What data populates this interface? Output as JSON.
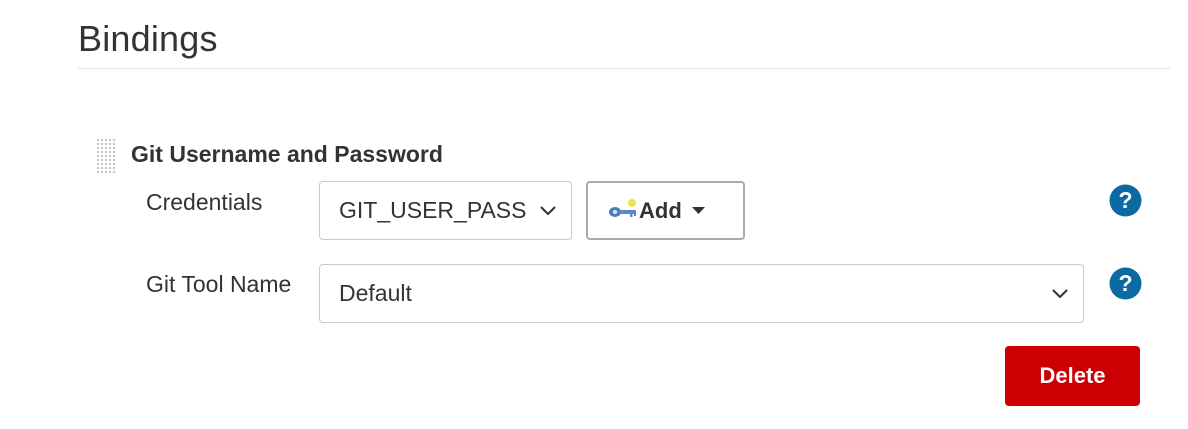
{
  "section": {
    "title": "Bindings"
  },
  "binding": {
    "title": "Git Username and Password",
    "credentials": {
      "label": "Credentials",
      "selected": "GIT_USER_PASS",
      "add_label": "Add"
    },
    "git_tool": {
      "label": "Git Tool Name",
      "selected": "Default"
    },
    "delete_label": "Delete"
  },
  "icons": {
    "drag": "drag-handle-icon",
    "key": "key-icon",
    "caret": "caret-down-icon",
    "chevron": "chevron-down-icon",
    "help": "help-icon"
  },
  "colors": {
    "delete_bg": "#cc0003",
    "help_bg": "#0b6aa2",
    "text": "#333333",
    "border": "#c9c9c9"
  }
}
